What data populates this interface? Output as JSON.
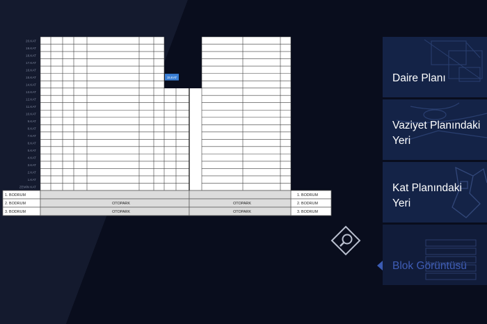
{
  "floors": {
    "labels": [
      "20.KAT",
      "19.KAT",
      "18.KAT",
      "17.KAT",
      "16.KAT",
      "15.KAT",
      "14.KAT",
      "13.KAT",
      "12.KAT",
      "11.KAT",
      "10.KAT",
      "9.KAT",
      "8.KAT",
      "7.KAT",
      "6.KAT",
      "5.KAT",
      "4.KAT",
      "3.KAT",
      "2.KAT",
      "1.KAT",
      "ZEMİN KAT"
    ],
    "highlight_tag": "15.KAT"
  },
  "basement": {
    "rows": [
      {
        "left": "1. BODRUM",
        "right": "1. BODRUM",
        "center": "",
        "park": ""
      },
      {
        "left": "2. BODRUM",
        "right": "2. BODRUM",
        "center": "OTOPARK",
        "park": "OTOPARK"
      },
      {
        "left": "3. BODRUM",
        "right": "3. BODRUM",
        "center": "OTOPARK",
        "park": "OTOPARK"
      }
    ]
  },
  "nav": [
    {
      "label": "Daire Planı",
      "active": false
    },
    {
      "label": "Vaziyet Planındaki Yeri",
      "active": false
    },
    {
      "label": "Kat Planındaki Yeri",
      "active": false
    },
    {
      "label": "Blok Görüntüsü",
      "active": true
    }
  ],
  "colors": {
    "background": "#070a16",
    "slab": "#141a2e",
    "nav_tile": "#142347",
    "active_text": "#3f5db6",
    "highlight": "#3a7fd6"
  },
  "icons": {
    "zoom": "magnifier-icon",
    "active_pointer": "caret-left-icon"
  }
}
